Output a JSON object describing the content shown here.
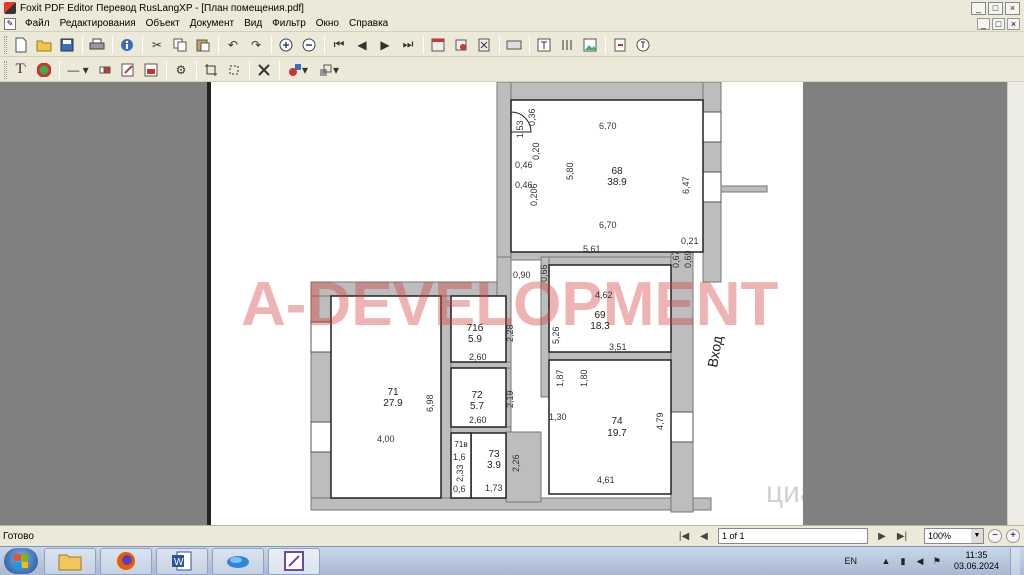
{
  "window": {
    "title": "Foxit PDF Editor Перевод RusLangXP - [План помещения.pdf]",
    "controls": [
      "_",
      "□",
      "×"
    ]
  },
  "menu": {
    "items": [
      "Файл",
      "Редактирования",
      "Объект",
      "Документ",
      "Вид",
      "Фильтр",
      "Окно",
      "Справка"
    ]
  },
  "document": {
    "watermark": "A-DEVELOPMENT",
    "corner_mark": "циан",
    "rooms": [
      {
        "id": "68",
        "area": "38.9"
      },
      {
        "id": "69",
        "area": "18.3"
      },
      {
        "id": "71",
        "area": "27.9"
      },
      {
        "id": "71б",
        "area": "5.9"
      },
      {
        "id": "72",
        "area": "5.7"
      },
      {
        "id": "73",
        "area": "3.9"
      },
      {
        "id": "74",
        "area": "19.7"
      },
      {
        "id": "71в",
        "area": ""
      }
    ],
    "dims": [
      "6,70",
      "5,80",
      "6,47",
      "6,70",
      "5,61",
      "0,36",
      "1,53",
      "0,20",
      "0,46",
      "0,46",
      "0,206",
      "0,21",
      "0,69",
      "0,67",
      "0,90",
      "0,66",
      "4,62",
      "5,26",
      "3,51",
      "1,87",
      "1,80",
      "1,30",
      "4,79",
      "4,61",
      "2,28",
      "2,60",
      "6,98",
      "4,00",
      "2,19",
      "2,60",
      "2,26",
      "1,73",
      "1,6",
      "2,33",
      "0,6"
    ],
    "entrance": "Вход"
  },
  "status": {
    "text": "Готово",
    "page": "1 of 1",
    "zoom": "100%"
  },
  "taskbar": {
    "lang": "EN",
    "time": "11:35",
    "date": "03.06.2024"
  }
}
